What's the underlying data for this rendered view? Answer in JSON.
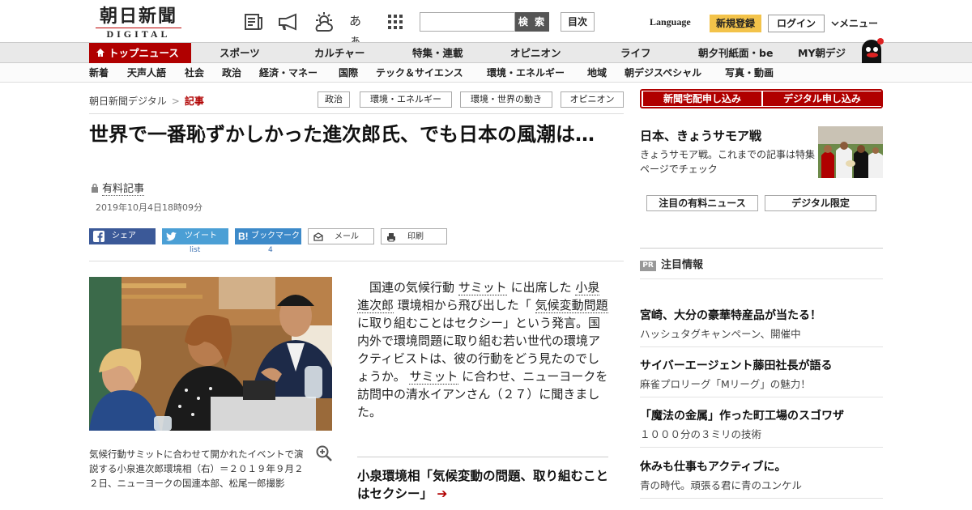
{
  "header": {
    "logo_jp": "朝日新聞",
    "logo_en": "DIGITAL",
    "icons": [
      "newspaper-icon",
      "megaphone-icon",
      "weather-icon",
      "font-size-icon",
      "grid-apps-icon"
    ],
    "font_icon_text": "あぁ",
    "search_button": "検 索",
    "toc_button": "目次",
    "language": "Language",
    "register_button": "新規登録",
    "login_button": "ログイン",
    "menu_button": "メニュー"
  },
  "nav_primary": [
    "トップニュース",
    "スポーツ",
    "カルチャー",
    "特集・連載",
    "オピニオン",
    "ライフ",
    "朝夕刊紙面・be",
    "MY朝デジ"
  ],
  "nav_secondary": [
    "新着",
    "天声人語",
    "社会",
    "政治",
    "経済・マネー",
    "国際",
    "テック＆サイエンス",
    "環境・エネルギー",
    "地域",
    "朝デジスペシャル",
    "写真・動画"
  ],
  "breadcrumb": {
    "home": "朝日新聞デジタル",
    "sep": ">",
    "current": "記事"
  },
  "tags": [
    "政治",
    "環境・エネルギー",
    "環境・世界の動き",
    "オピニオン"
  ],
  "article": {
    "title": "世界で一番恥ずかしかった進次郎氏、でも日本の風潮は…",
    "paid_label": "有料記事",
    "date": "2019年10月4日18時09分",
    "share": {
      "facebook": "シェア",
      "twitter": "ツイート",
      "hatena": "ブックマーク",
      "mail": "メール",
      "print": "印刷",
      "twitter_count": "list",
      "hatena_count": "4"
    },
    "photo_caption": "気候行動サミットに合わせて開かれたイベントで演説する小泉進次郎環境相（右）＝２０１９年９月２２日、ニューヨークの国連本部、松尾一郎撮影",
    "body_parts": [
      "国連の気候行動",
      "サミット",
      "に出席した",
      "小泉進次郎",
      "環境相から飛び出した「",
      "気候変動問題",
      "に取り組むことはセクシー」という発言。国内外で環境問題に取り組む若い世代の環境アクティビストは、彼の行動をどう見たのでしょうか。",
      "サミット",
      "に合わせ、ニューヨークを訪問中の清水イアンさん（２７）に聞きました。"
    ],
    "related": "小泉環境相「気候変動の問題、取り組むことはセクシー」",
    "related_arrow": "➔"
  },
  "sidebar": {
    "delivery_button": "新聞宅配申し込み",
    "digital_button": "デジタル申し込み",
    "feature_title": "日本、きょうサモア戦",
    "feature_text": "きょうサモア戦。これまでの記事は特集ページでチェック",
    "pill_paid": "注目の有料ニュース",
    "pill_digital": "デジタル限定",
    "pr_badge": "PR",
    "pr_title": "注目情報",
    "ads": [
      {
        "title": "宮崎、大分の豪華特産品が当たる！",
        "sub": "ハッシュタグキャンペーン、開催中"
      },
      {
        "title": "サイバーエージェント藤田社長が語る",
        "sub": "麻雀プロリーグ「Mリーグ」の魅力！"
      },
      {
        "title": "「魔法の金属」作った町工場のスゴワザ",
        "sub": "１０００分の３ミリの技術"
      },
      {
        "title": "休みも仕事もアクティブに。",
        "sub": "青の時代。頑張る君に青のユンケル"
      }
    ]
  },
  "colors": {
    "brand_red": "#b00000",
    "register_yellow": "#f3c34a",
    "facebook": "#3b5998",
    "twitter": "#4b9fd5",
    "hatena": "#3d8ac9"
  }
}
